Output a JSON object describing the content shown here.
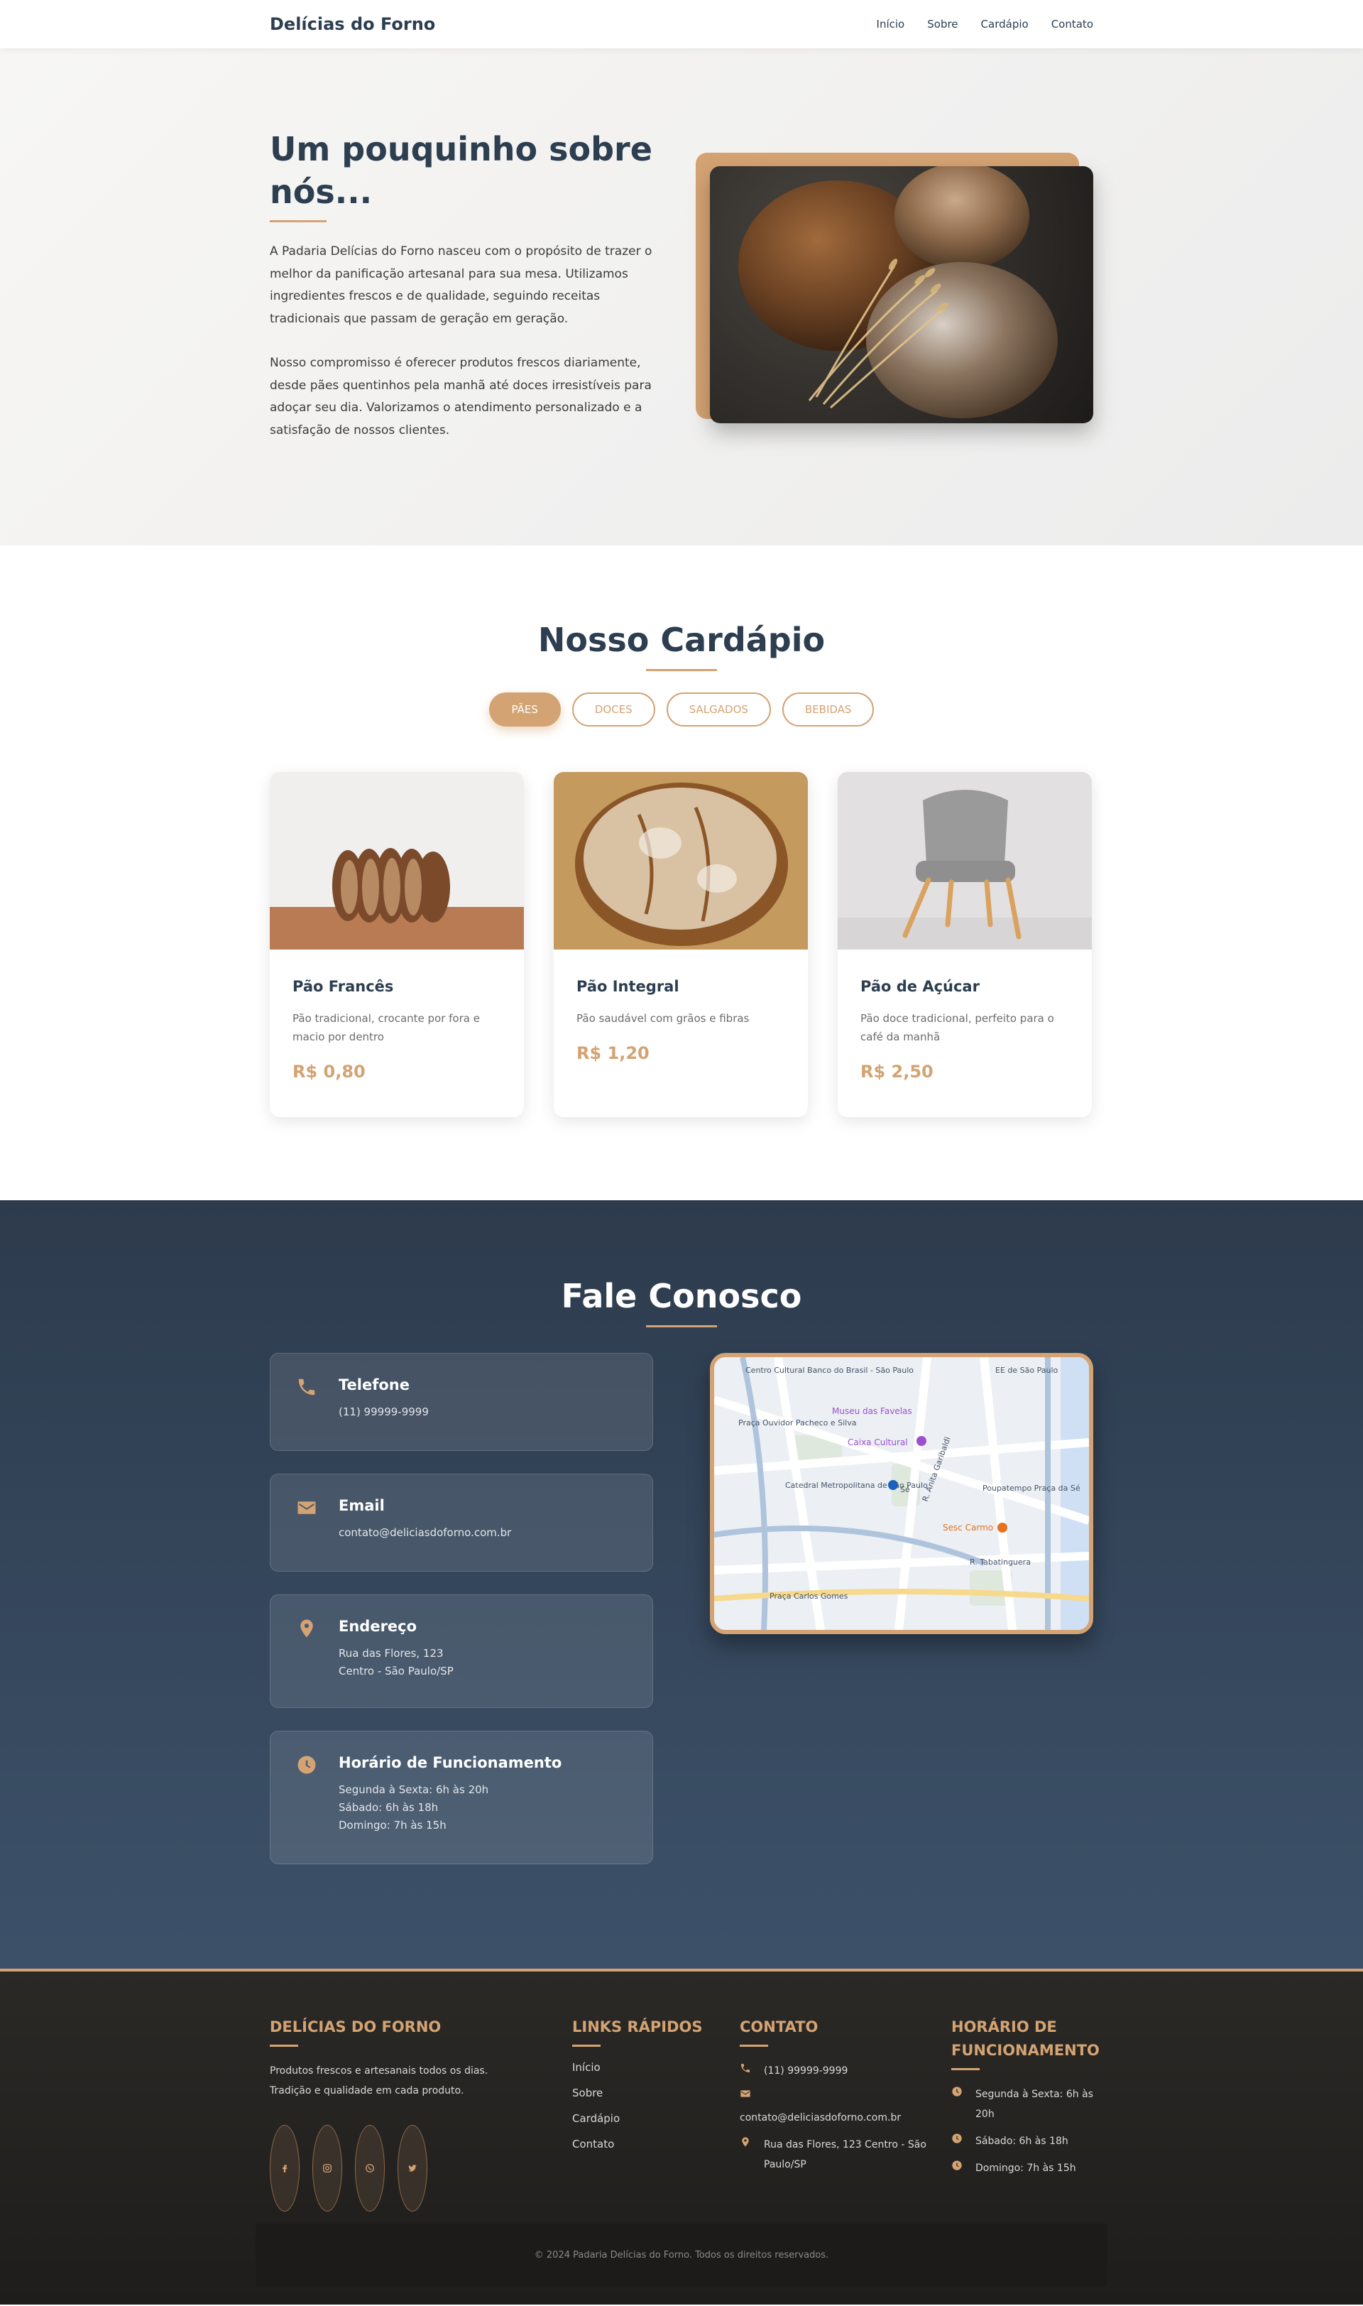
{
  "navbar": {
    "brand": "Delícias do Forno",
    "links": [
      "Início",
      "Sobre",
      "Cardápio",
      "Contato"
    ]
  },
  "about": {
    "title": "Um pouquinho sobre nós...",
    "paragraph1": "A Padaria Delícias do Forno nasceu com o propósito de trazer o melhor da panificação artesanal para sua mesa. Utilizamos ingredientes frescos e de qualidade, seguindo receitas tradicionais que passam de geração em geração.",
    "paragraph2": "Nosso compromisso é oferecer produtos frescos diariamente, desde pães quentinhos pela manhã até doces irresistíveis para adoçar seu dia. Valorizamos o atendimento personalizado e a satisfação de nossos clientes."
  },
  "menu": {
    "title": "Nosso Cardápio",
    "filters": [
      "PÃES",
      "DOCES",
      "SALGADOS",
      "BEBIDAS"
    ],
    "active_filter": "PÃES",
    "items": [
      {
        "name": "Pão Francês",
        "description": "Pão tradicional, crocante por fora e macio por dentro",
        "price": "R$ 0,80"
      },
      {
        "name": "Pão Integral",
        "description": "Pão saudável com grãos e fibras",
        "price": "R$ 1,20"
      },
      {
        "name": "Pão de Açúcar",
        "description": "Pão doce tradicional, perfeito para o café da manhã",
        "price": "R$ 2,50"
      }
    ]
  },
  "contact": {
    "title": "Fale Conosco",
    "phone": {
      "label": "Telefone",
      "lines": [
        "(11) 99999-9999"
      ]
    },
    "email": {
      "label": "Email",
      "lines": [
        "contato@deliciasdoforno.com.br"
      ]
    },
    "address": {
      "label": "Endereço",
      "lines": [
        "Rua das Flores, 123",
        "Centro - São Paulo/SP"
      ]
    },
    "hours": {
      "label": "Horário de Funcionamento",
      "lines": [
        "Segunda à Sexta: 6h às 20h",
        "Sábado: 6h às 18h",
        "Domingo: 7h às 15h"
      ]
    },
    "map_labels": {
      "l1": "Centro Cultural Banco do Brasil - São Paulo",
      "l2": "Museu das Favelas",
      "l3": "Praça Ouvidor Pacheco e Silva",
      "l4": "Caixa Cultural",
      "l5": "Catedral Metropolitana de São Paulo",
      "l6": "Poupatempo Praça da Sé",
      "l7": "Sesc Carmo",
      "l8": "R. Tabatinguera",
      "l9": "Praça Carlos Gomes",
      "l10": "EE de São Paulo",
      "l11": "Sé",
      "l12": "R. Anita Garibaldi"
    }
  },
  "footer": {
    "brand_title": "DELÍCIAS DO FORNO",
    "brand_text": "Produtos frescos e artesanais todos os dias. Tradição e qualidade em cada produto.",
    "social_icons": [
      "facebook-icon",
      "instagram-icon",
      "whatsapp-icon",
      "twitter-icon"
    ],
    "links_title": "LINKS RÁPIDOS",
    "links": [
      "Início",
      "Sobre",
      "Cardápio",
      "Contato"
    ],
    "contact_title": "CONTATO",
    "contact_phone": "(11) 99999-9999",
    "contact_email": "contato@deliciasdoforno.com.br",
    "contact_address": "Rua das Flores, 123 Centro - São Paulo/SP",
    "hours_title": "HORÁRIO DE FUNCIONAMENTO",
    "hours": [
      "Segunda à Sexta: 6h às 20h",
      "Sábado: 6h às 18h",
      "Domingo: 7h às 15h"
    ],
    "copyright": "© 2024 Padaria Delícias do Forno. Todos os direitos reservados."
  },
  "colors": {
    "accent": "#d4a373",
    "dark": "#2c3e50"
  }
}
